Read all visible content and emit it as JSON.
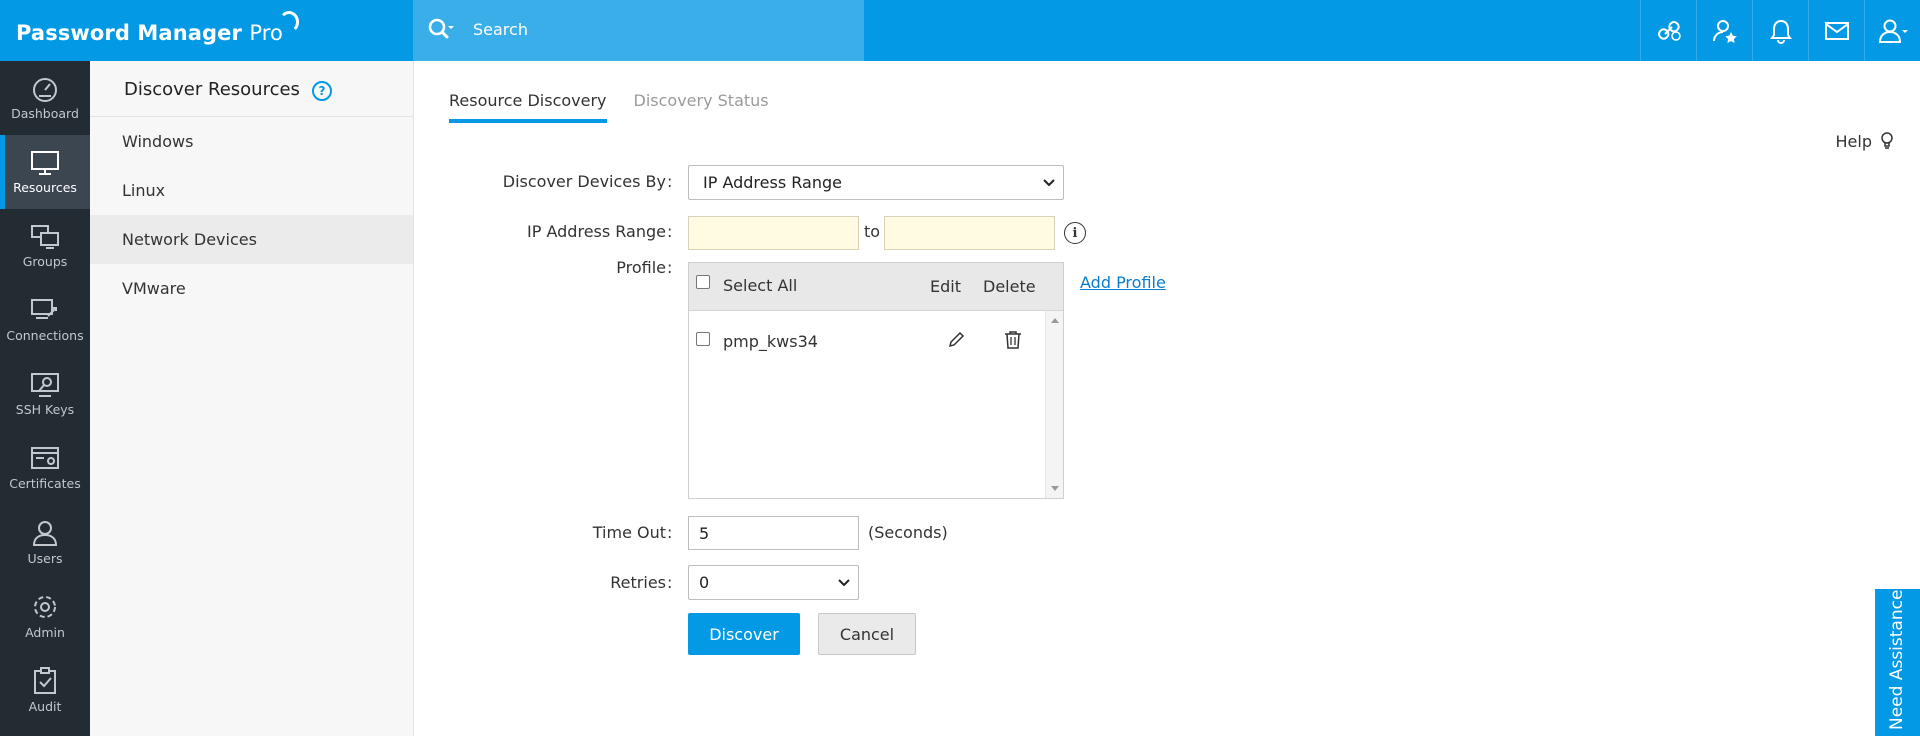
{
  "app": {
    "title_main": "Password Manager",
    "title_suffix": "Pro"
  },
  "search": {
    "placeholder": "Search"
  },
  "topbar_icons": [
    "link-icon",
    "user-star-icon",
    "bell-icon",
    "mail-icon",
    "user-account-icon"
  ],
  "leftnav": {
    "items": [
      {
        "label": "Dashboard",
        "icon": "gauge-icon"
      },
      {
        "label": "Resources",
        "icon": "monitor-icon",
        "active": true
      },
      {
        "label": "Groups",
        "icon": "monitor-group-icon"
      },
      {
        "label": "Connections",
        "icon": "connection-icon"
      },
      {
        "label": "SSH Keys",
        "icon": "ssh-key-icon"
      },
      {
        "label": "Certificates",
        "icon": "certificate-icon"
      },
      {
        "label": "Users",
        "icon": "user-icon"
      },
      {
        "label": "Admin",
        "icon": "gear-icon"
      },
      {
        "label": "Audit",
        "icon": "clipboard-check-icon"
      }
    ]
  },
  "subpanel": {
    "title": "Discover Resources",
    "help": "?",
    "items": [
      {
        "label": "Windows"
      },
      {
        "label": "Linux"
      },
      {
        "label": "Network Devices",
        "active": true
      },
      {
        "label": "VMware"
      }
    ]
  },
  "tabs": [
    {
      "label": "Resource Discovery",
      "active": true
    },
    {
      "label": "Discovery Status",
      "active": false
    }
  ],
  "help_link": "Help",
  "form": {
    "discover_by": {
      "label": "Discover Devices By",
      "value": "IP Address Range"
    },
    "ip_range": {
      "label": "IP Address Range",
      "from": "",
      "to_label": "to",
      "to": "",
      "info": "i"
    },
    "profile": {
      "label": "Profile",
      "select_all": "Select All",
      "edit_header": "Edit",
      "delete_header": "Delete",
      "rows": [
        {
          "name": "pmp_kws34"
        }
      ],
      "add_profile": "Add Profile"
    },
    "timeout": {
      "label": "Time Out",
      "value": "5",
      "unit": "(Seconds)"
    },
    "retries": {
      "label": "Retries",
      "value": "0"
    },
    "colon": ":"
  },
  "buttons": {
    "discover": "Discover",
    "cancel": "Cancel"
  },
  "need_assistance": "Need Assistance?",
  "colors": {
    "brand": "#0499e4",
    "nav_bg": "#232b33",
    "ip_input_bg": "#fffbe0"
  }
}
